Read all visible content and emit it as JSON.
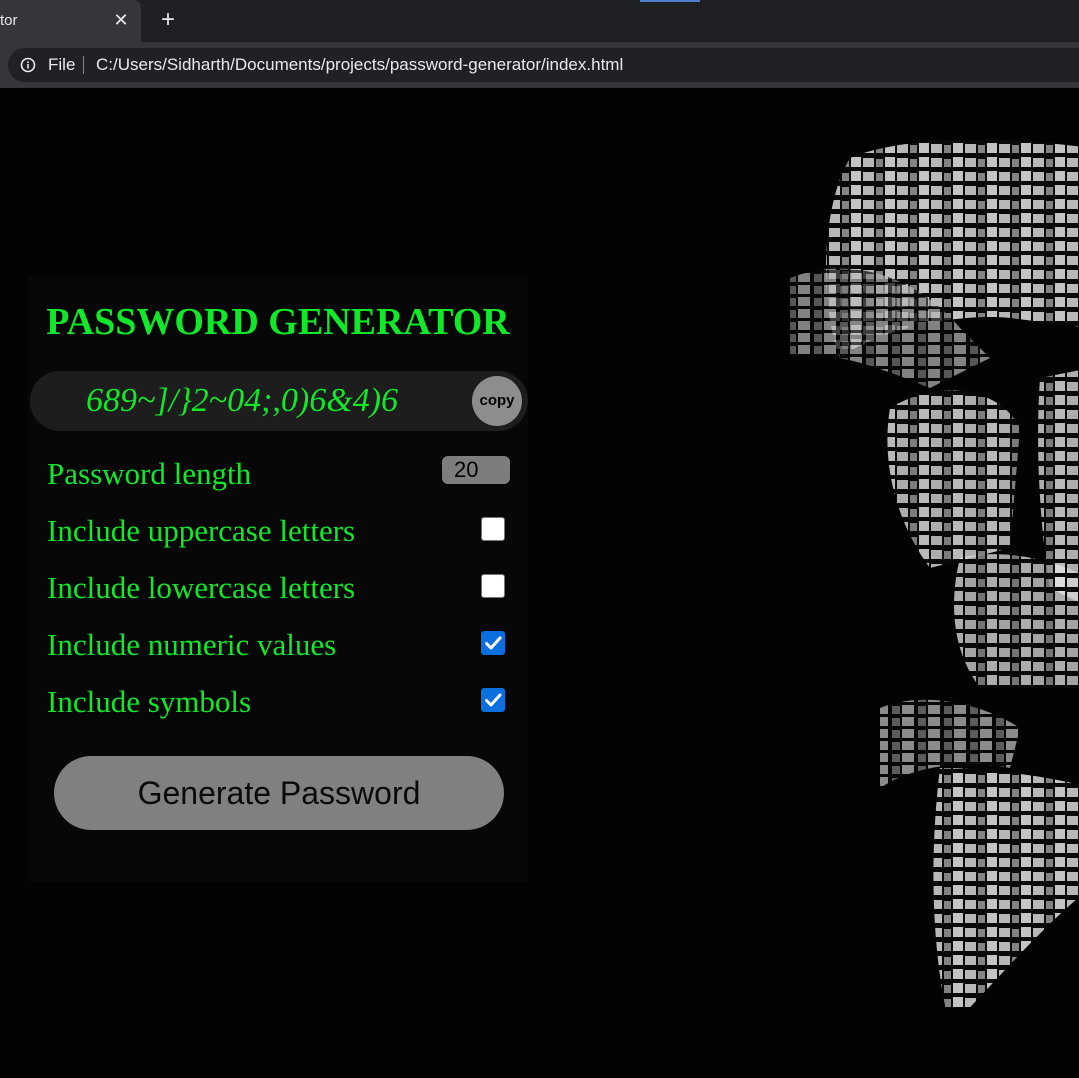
{
  "browser": {
    "tab_title": "tor",
    "tab_close": "✕",
    "new_tab": "+",
    "address_scheme": "File",
    "url": "C:/Users/Sidharth/Documents/projects/password-generator/index.html"
  },
  "app": {
    "title": "PASSWORD GENERATOR",
    "password": "689~]/}2~04;,0)6&4)6",
    "copy_label": "copy",
    "length_label": "Password length",
    "length_value": "20",
    "options": [
      {
        "label": "Include uppercase letters",
        "checked": false
      },
      {
        "label": "Include lowercase letters",
        "checked": false
      },
      {
        "label": "Include numeric values",
        "checked": true
      },
      {
        "label": "Include symbols",
        "checked": true
      }
    ],
    "generate_label": "Generate Password"
  },
  "colors": {
    "accent_green": "#12e82a",
    "checkbox_blue": "#0b6fe0",
    "background": "#030305"
  }
}
